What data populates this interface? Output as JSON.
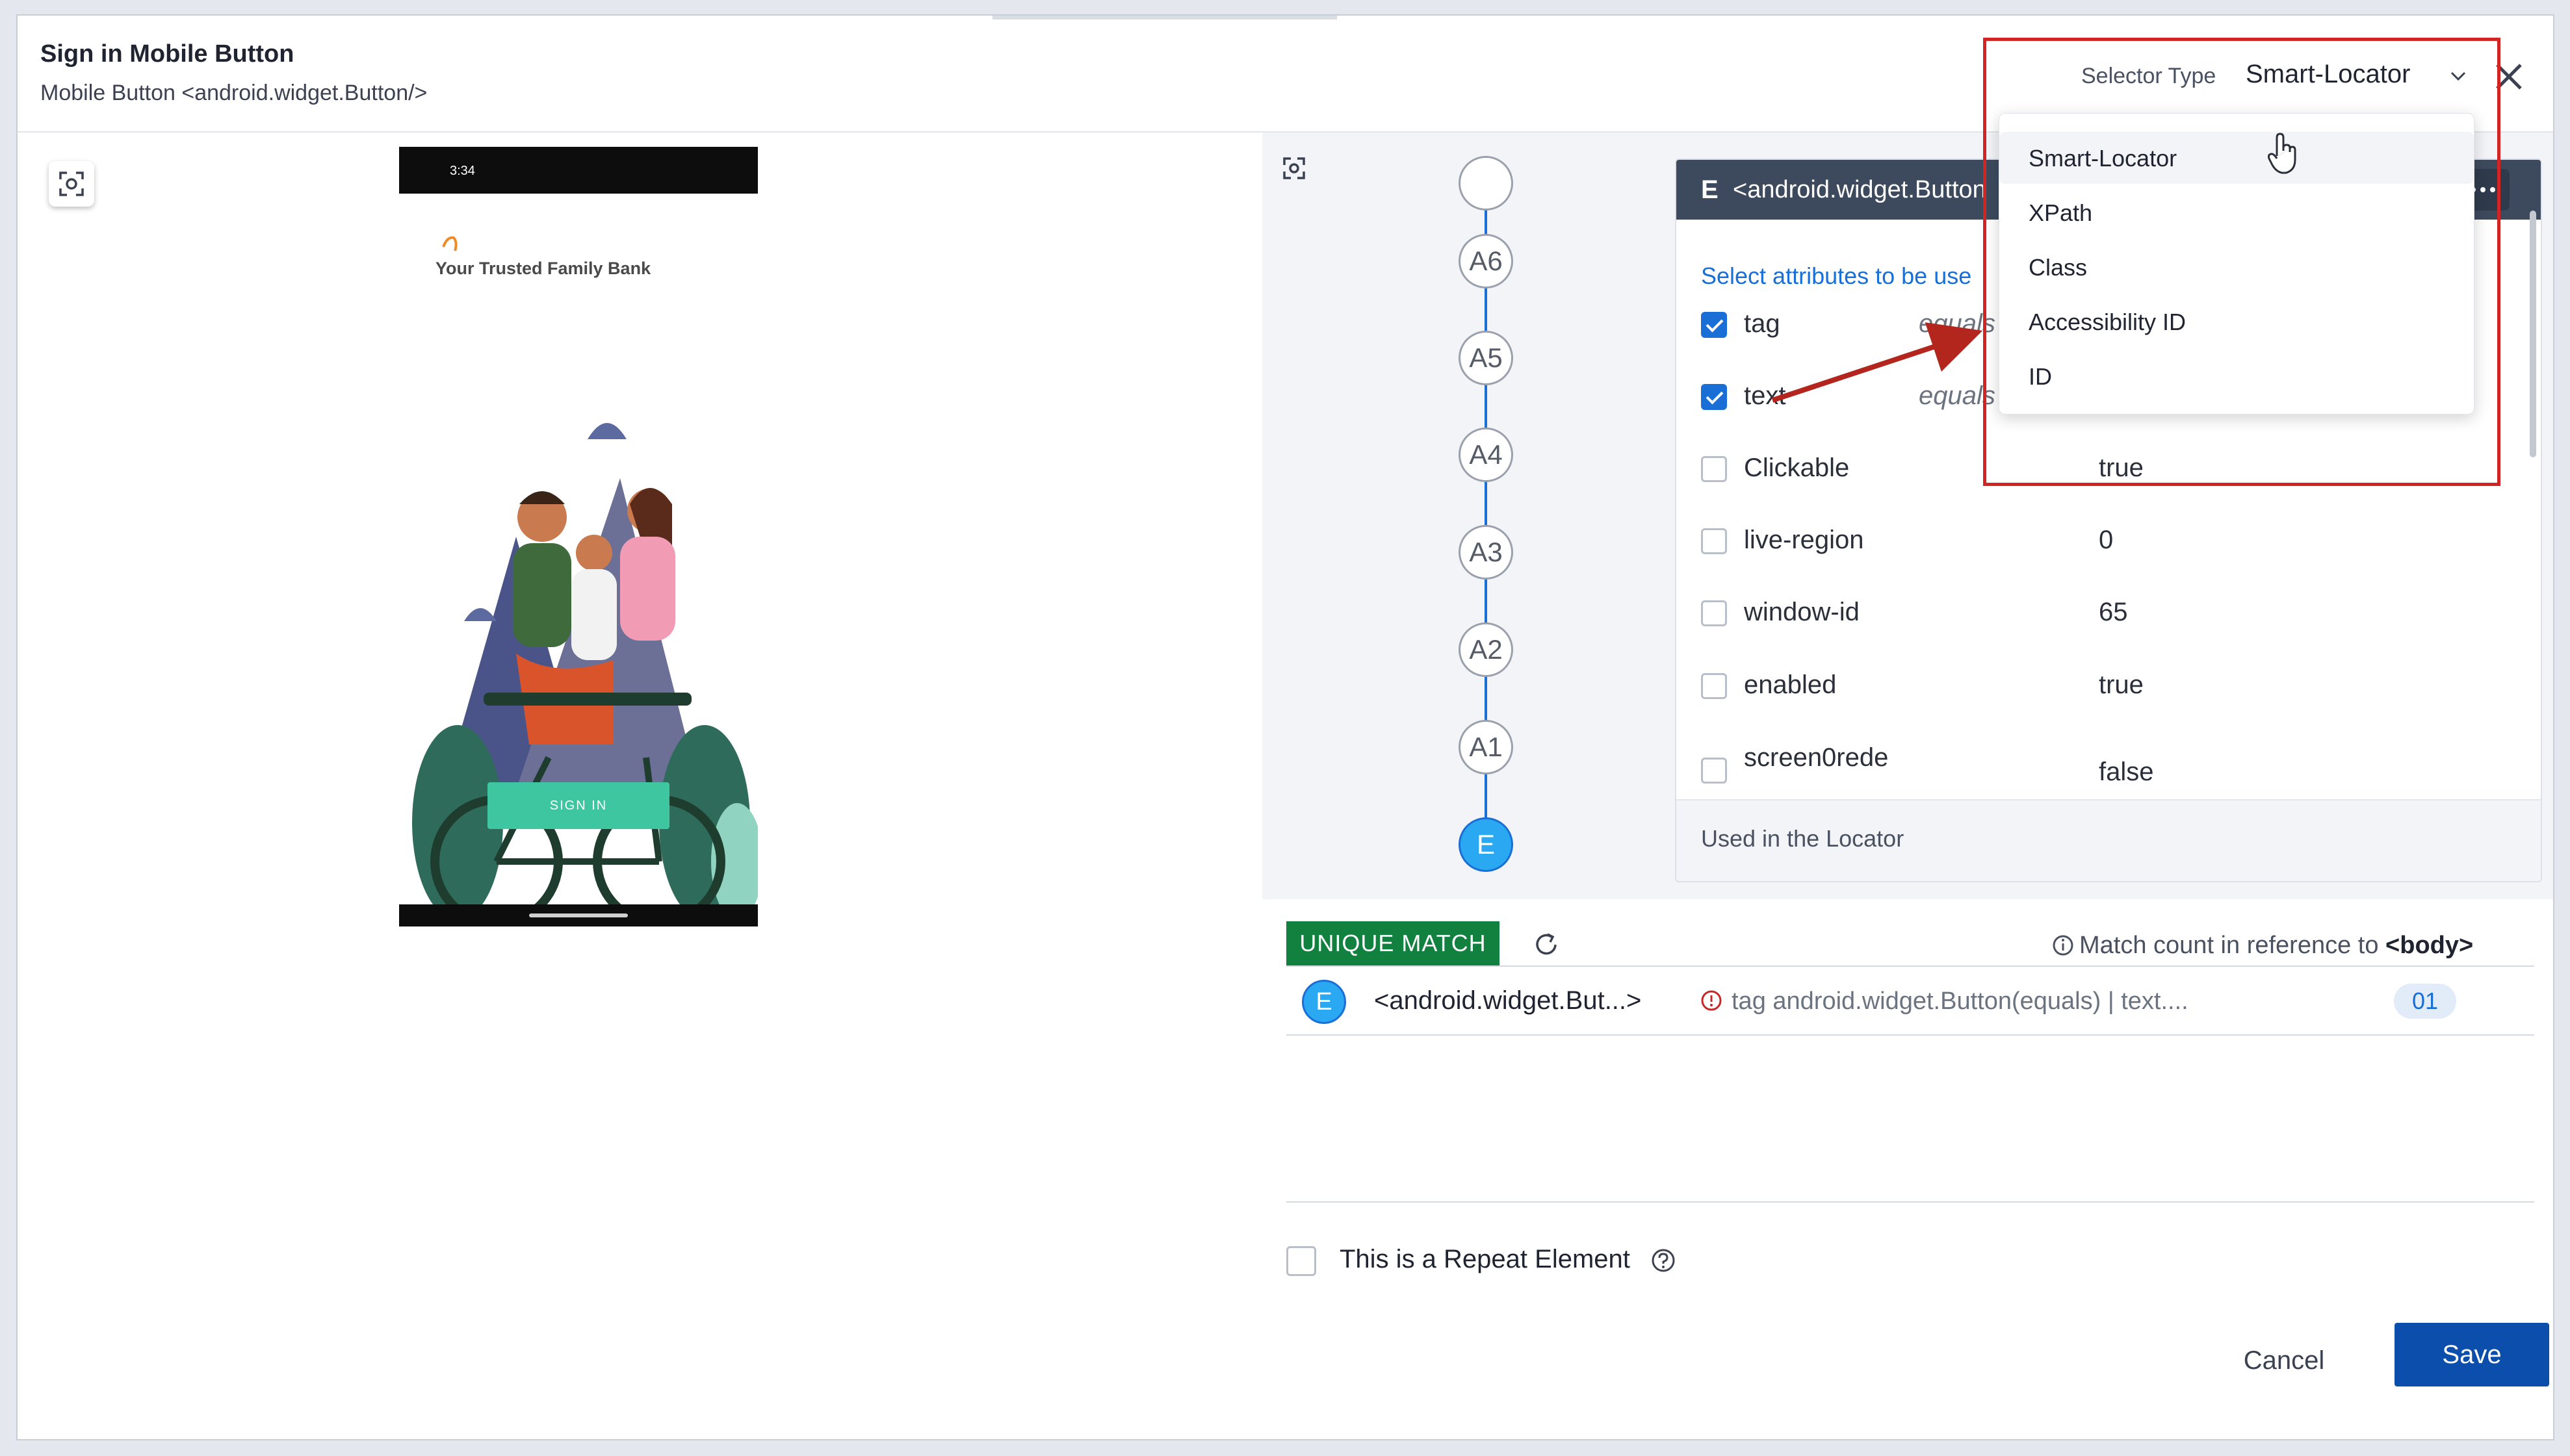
{
  "header": {
    "title": "Sign in Mobile Button",
    "subtitle": "Mobile Button <android.widget.Button/>",
    "selector_label": "Selector Type",
    "selector_value": "Smart-Locator"
  },
  "phone": {
    "status_time": "3:34",
    "brand": "Your Trusted Family Bank",
    "sign_in": "SIGN IN"
  },
  "tree": {
    "nodes": [
      "A6",
      "A5",
      "A4",
      "A3",
      "A2",
      "A1",
      "E"
    ]
  },
  "card": {
    "badge": "E",
    "title": "<android.widget.Button",
    "hint": "Select attributes to be use",
    "attributes": [
      {
        "name": "tag",
        "op": "equals",
        "value": "",
        "checked": true
      },
      {
        "name": "text",
        "op": "equals",
        "value": "",
        "checked": true
      },
      {
        "name": "Clickable",
        "op": "",
        "value": "true",
        "checked": false
      },
      {
        "name": "live-region",
        "op": "",
        "value": "0",
        "checked": false
      },
      {
        "name": "window-id",
        "op": "",
        "value": "65",
        "checked": false
      },
      {
        "name": "enabled",
        "op": "",
        "value": "true",
        "checked": false
      },
      {
        "name": "screen0rede",
        "op": "",
        "value": "false",
        "checked": false
      }
    ],
    "footer": "Used in the Locator"
  },
  "match": {
    "badge": "UNIQUE MATCH",
    "info_prefix": "Match count in reference to",
    "info_ref": "<body>",
    "row": {
      "badge": "E",
      "tag": "<android.widget.But...>",
      "desc": "tag android.widget.Button(equals) | text....",
      "count": "01"
    }
  },
  "repeat": {
    "label": "This is a Repeat Element"
  },
  "actions": {
    "cancel": "Cancel",
    "save": "Save"
  },
  "dropdown": {
    "options": [
      "Smart-Locator",
      "XPath",
      "Class",
      "Accessibility ID",
      "ID"
    ]
  },
  "colors": {
    "accent": "#1a6fd6",
    "match_green": "#12813f",
    "save_blue": "#0b4eab",
    "highlight_red": "#d32424"
  }
}
